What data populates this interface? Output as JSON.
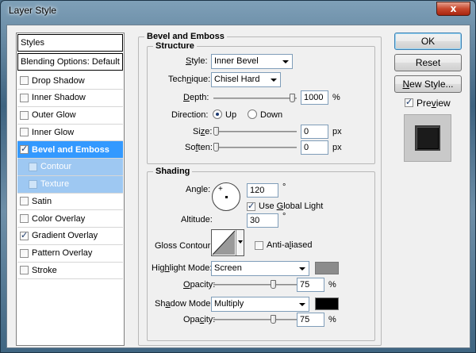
{
  "window": {
    "title": "Layer Style",
    "close_glyph": "x"
  },
  "left_panel": {
    "styles_header": "Styles",
    "blending_header": "Blending Options: Default",
    "items": [
      {
        "label": "Drop Shadow",
        "checked": false,
        "state": "normal"
      },
      {
        "label": "Inner Shadow",
        "checked": false,
        "state": "normal"
      },
      {
        "label": "Outer Glow",
        "checked": false,
        "state": "normal"
      },
      {
        "label": "Inner Glow",
        "checked": false,
        "state": "normal"
      },
      {
        "label": "Bevel and Emboss",
        "checked": true,
        "state": "selected"
      },
      {
        "label": "Contour",
        "checked": false,
        "state": "sub"
      },
      {
        "label": "Texture",
        "checked": false,
        "state": "sub"
      },
      {
        "label": "Satin",
        "checked": false,
        "state": "normal"
      },
      {
        "label": "Color Overlay",
        "checked": false,
        "state": "normal"
      },
      {
        "label": "Gradient Overlay",
        "checked": true,
        "state": "normal"
      },
      {
        "label": "Pattern Overlay",
        "checked": false,
        "state": "normal"
      },
      {
        "label": "Stroke",
        "checked": false,
        "state": "normal"
      }
    ]
  },
  "bevel": {
    "title": "Bevel and Emboss",
    "structure": {
      "title": "Structure",
      "style_label": "Style:",
      "style_value": "Inner Bevel",
      "technique_label": "Technique:",
      "technique_value": "Chisel Hard",
      "depth_label": "Depth:",
      "depth_value": "1000",
      "depth_unit": "%",
      "depth_level": 1.0,
      "direction_label": "Direction:",
      "direction_up": "Up",
      "direction_down": "Down",
      "direction_selected": "Up",
      "size_label": "Size:",
      "size_value": "0",
      "size_unit": "px",
      "soften_label": "Soften:",
      "soften_value": "0",
      "soften_unit": "px"
    },
    "shading": {
      "title": "Shading",
      "angle_label": "Angle:",
      "angle_value": "120",
      "angle_unit": "°",
      "global_light_label": "Use Global Light",
      "global_light_checked": true,
      "altitude_label": "Altitude:",
      "altitude_value": "30",
      "altitude_unit": "°",
      "gloss_label": "Gloss Contour:",
      "anti_aliased_label": "Anti-aliased",
      "highlight_mode_label": "Highlight Mode:",
      "highlight_mode_value": "Screen",
      "highlight_color": "#8c8c8c",
      "highlight_opacity_label": "Opacity:",
      "highlight_opacity_value": "75",
      "highlight_opacity_unit": "%",
      "shadow_mode_label": "Shadow Mode:",
      "shadow_mode_value": "Multiply",
      "shadow_color": "#000000",
      "shadow_opacity_label": "Opacity:",
      "shadow_opacity_value": "75",
      "shadow_opacity_unit": "%"
    }
  },
  "buttons": {
    "ok": "OK",
    "reset": "Reset",
    "new_style": "New Style...",
    "preview_label": "Preview",
    "preview_checked": true
  }
}
